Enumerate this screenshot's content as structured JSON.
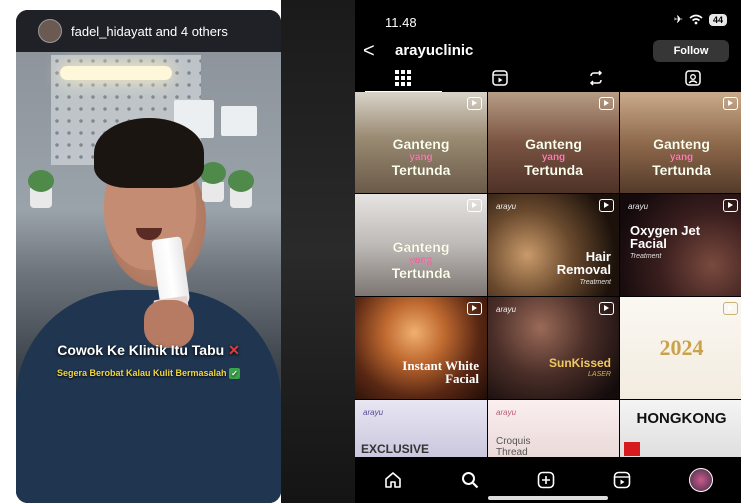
{
  "reel": {
    "user_line": "fadel_hidayatt and 4 others",
    "caption_main": "Cowok Ke Klinik Itu Tabu",
    "caption_x": "✕",
    "caption_sub": "Segera Berobat Kalau Kulit Bermasalah",
    "caption_check": "✓"
  },
  "phone": {
    "time": "11.48",
    "battery": "44",
    "back_glyph": "<",
    "handle": "arayuclinic",
    "follow_label": "Follow",
    "tabs": [
      "grid-icon",
      "reels-icon",
      "repost-icon",
      "tagged-icon"
    ],
    "tiles": [
      {
        "title_a": "Ganteng",
        "title_b": "yang",
        "title_c": "Tertunda",
        "bg": "#b7a796"
      },
      {
        "title_a": "Ganteng",
        "title_b": "yang",
        "title_c": "Tertunda",
        "bg": "#8f6b58"
      },
      {
        "title_a": "Ganteng",
        "title_b": "yang",
        "title_c": "Tertunda",
        "bg": "#a58a6e"
      },
      {
        "title_a": "Ganteng",
        "title_b": "yang",
        "title_c": "Tertunda",
        "bg": "#c9c6c4"
      },
      {
        "brand": "arayu",
        "title": "Hair Removal",
        "sub": "Treatment"
      },
      {
        "brand": "arayu",
        "title": "Oxygen Jet Facial",
        "sub": "Treatment"
      },
      {
        "title": "Instant White Facial"
      },
      {
        "brand": "arayu",
        "title": "SunKissed",
        "sub": "LASER"
      },
      {
        "title": "2024"
      },
      {
        "brand": "arayu",
        "title": "EXCLUSIVE"
      },
      {
        "brand": "arayu",
        "title": "Croquis Thread"
      },
      {
        "title": "HONGKONG"
      }
    ],
    "bottom_nav": [
      "home-icon",
      "search-icon",
      "create-icon",
      "reels-icon",
      "profile-avatar"
    ]
  }
}
